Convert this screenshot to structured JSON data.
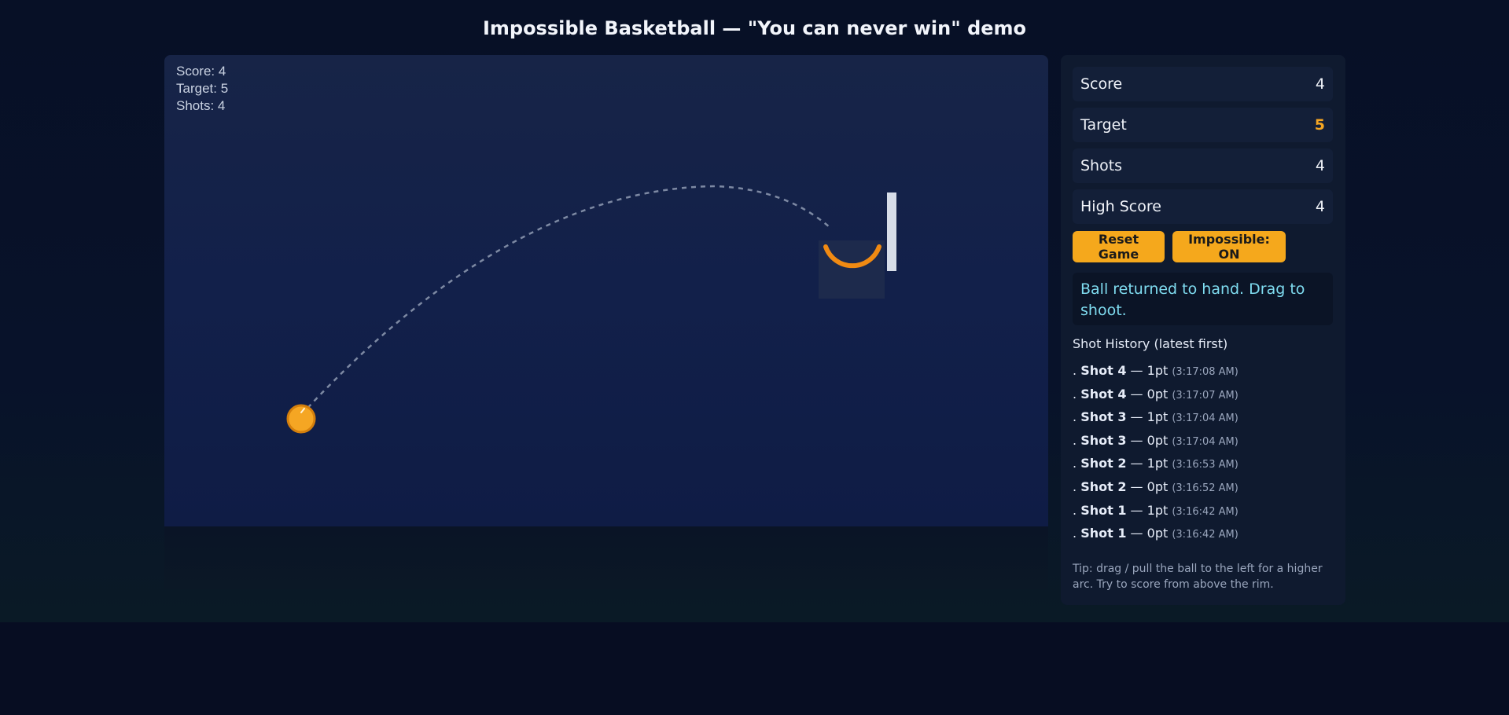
{
  "page": {
    "title": "Impossible Basketball — \"You can never win\" demo"
  },
  "hud": {
    "score": "Score: 4",
    "target": "Target: 5",
    "shots": "Shots: 4"
  },
  "stats": [
    {
      "label": "Score",
      "value": "4"
    },
    {
      "label": "Target",
      "value": "5"
    },
    {
      "label": "Shots",
      "value": "4"
    },
    {
      "label": "High Score",
      "value": "4"
    }
  ],
  "buttons": {
    "reset": "Reset Game",
    "impossible": "Impossible: ON"
  },
  "status": "Ball returned to hand. Drag to shoot.",
  "history": {
    "title": "Shot History (latest first)",
    "prefix": ".",
    "items": [
      {
        "shot": "Shot 4",
        "sep": "—",
        "pts": "1pt",
        "time": "(3:17:08 AM)"
      },
      {
        "shot": "Shot 4",
        "sep": "—",
        "pts": "0pt",
        "time": "(3:17:07 AM)"
      },
      {
        "shot": "Shot 3",
        "sep": "—",
        "pts": "1pt",
        "time": "(3:17:04 AM)"
      },
      {
        "shot": "Shot 3",
        "sep": "—",
        "pts": "0pt",
        "time": "(3:17:04 AM)"
      },
      {
        "shot": "Shot 2",
        "sep": "—",
        "pts": "1pt",
        "time": "(3:16:53 AM)"
      },
      {
        "shot": "Shot 2",
        "sep": "—",
        "pts": "0pt",
        "time": "(3:16:52 AM)"
      },
      {
        "shot": "Shot 1",
        "sep": "—",
        "pts": "1pt",
        "time": "(3:16:42 AM)"
      },
      {
        "shot": "Shot 1",
        "sep": "—",
        "pts": "0pt",
        "time": "(3:16:42 AM)"
      }
    ]
  },
  "tip": "Tip: drag / pull the ball to the left for a higher arc. Try to score from above the rim.",
  "colors": {
    "accent": "#f5a81c",
    "status_text": "#7fdcf0",
    "rim": "#f08a12",
    "ball": "#f5a623"
  },
  "icons": {
    "ball": "basketball-icon",
    "hoop": "hoop-icon",
    "trajectory": "trajectory-icon"
  }
}
